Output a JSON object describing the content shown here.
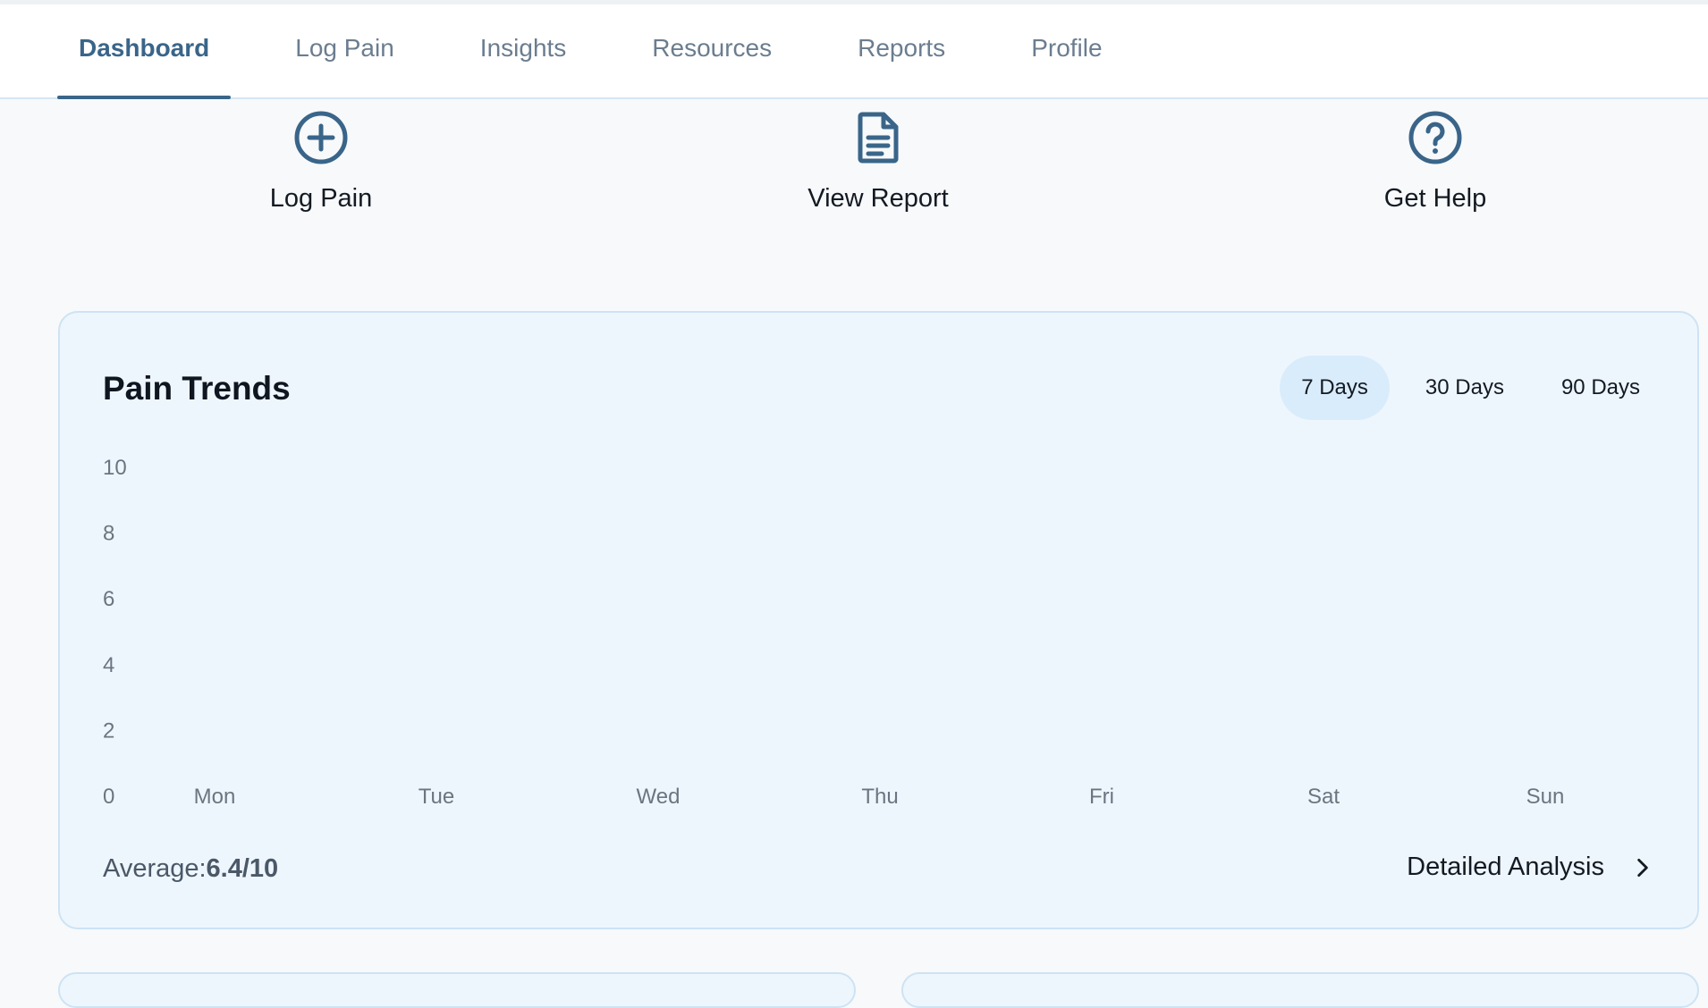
{
  "nav": {
    "tabs": [
      {
        "label": "Dashboard",
        "active": true
      },
      {
        "label": "Log Pain"
      },
      {
        "label": "Insights"
      },
      {
        "label": "Resources"
      },
      {
        "label": "Reports"
      },
      {
        "label": "Profile"
      }
    ]
  },
  "quick_actions": [
    {
      "label": "Log Pain",
      "icon": "plus-circle-icon"
    },
    {
      "label": "View Report",
      "icon": "document-icon"
    },
    {
      "label": "Get Help",
      "icon": "help-circle-icon"
    }
  ],
  "trends": {
    "title": "Pain Trends",
    "ranges": [
      {
        "label": "7 Days",
        "active": true
      },
      {
        "label": "30 Days"
      },
      {
        "label": "90 Days"
      }
    ],
    "average_label": "Average:",
    "average_value": "6.4/10",
    "detail_link": "Detailed Analysis"
  },
  "chart_data": {
    "type": "bar",
    "categories": [
      "Mon",
      "Tue",
      "Wed",
      "Thu",
      "Fri",
      "Sat",
      "Sun"
    ],
    "y_ticks": [
      "0",
      "2",
      "4",
      "6",
      "8",
      "10"
    ],
    "ylim": [
      0,
      10
    ],
    "grid": false
  },
  "colors": {
    "accent": "#3a6589",
    "card_bg": "#eef6fd",
    "card_border": "#cde3f4",
    "active_pill": "#d9ecfb"
  }
}
